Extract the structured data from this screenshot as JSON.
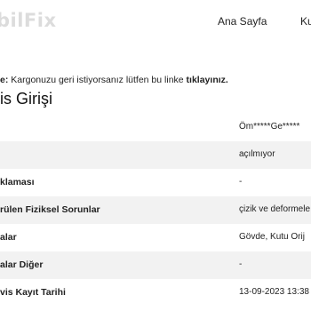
{
  "header": {
    "logo_text": "bilFix",
    "nav": [
      "Ana Sayfa",
      "Ku"
    ]
  },
  "notice": {
    "prefix": "e:",
    "text": " Kargonuzu geri istiyorsanız lütfen bu linke ",
    "link": "tıklayınız."
  },
  "page_title": "is Girişi",
  "rows": [
    {
      "label": "",
      "value": "Öm*****Ge*****"
    },
    {
      "label": "",
      "value": "açılmıyor"
    },
    {
      "label": "klaması",
      "value": "-"
    },
    {
      "label": "rülen Fiziksel Sorunlar",
      "value": "çizik ve deformele"
    },
    {
      "label": "alar",
      "value": "Gövde, Kutu Orij"
    },
    {
      "label": "alar Diğer",
      "value": "-"
    },
    {
      "label": "vis Kayıt Tarihi",
      "value": "13-09-2023 13:38"
    }
  ]
}
